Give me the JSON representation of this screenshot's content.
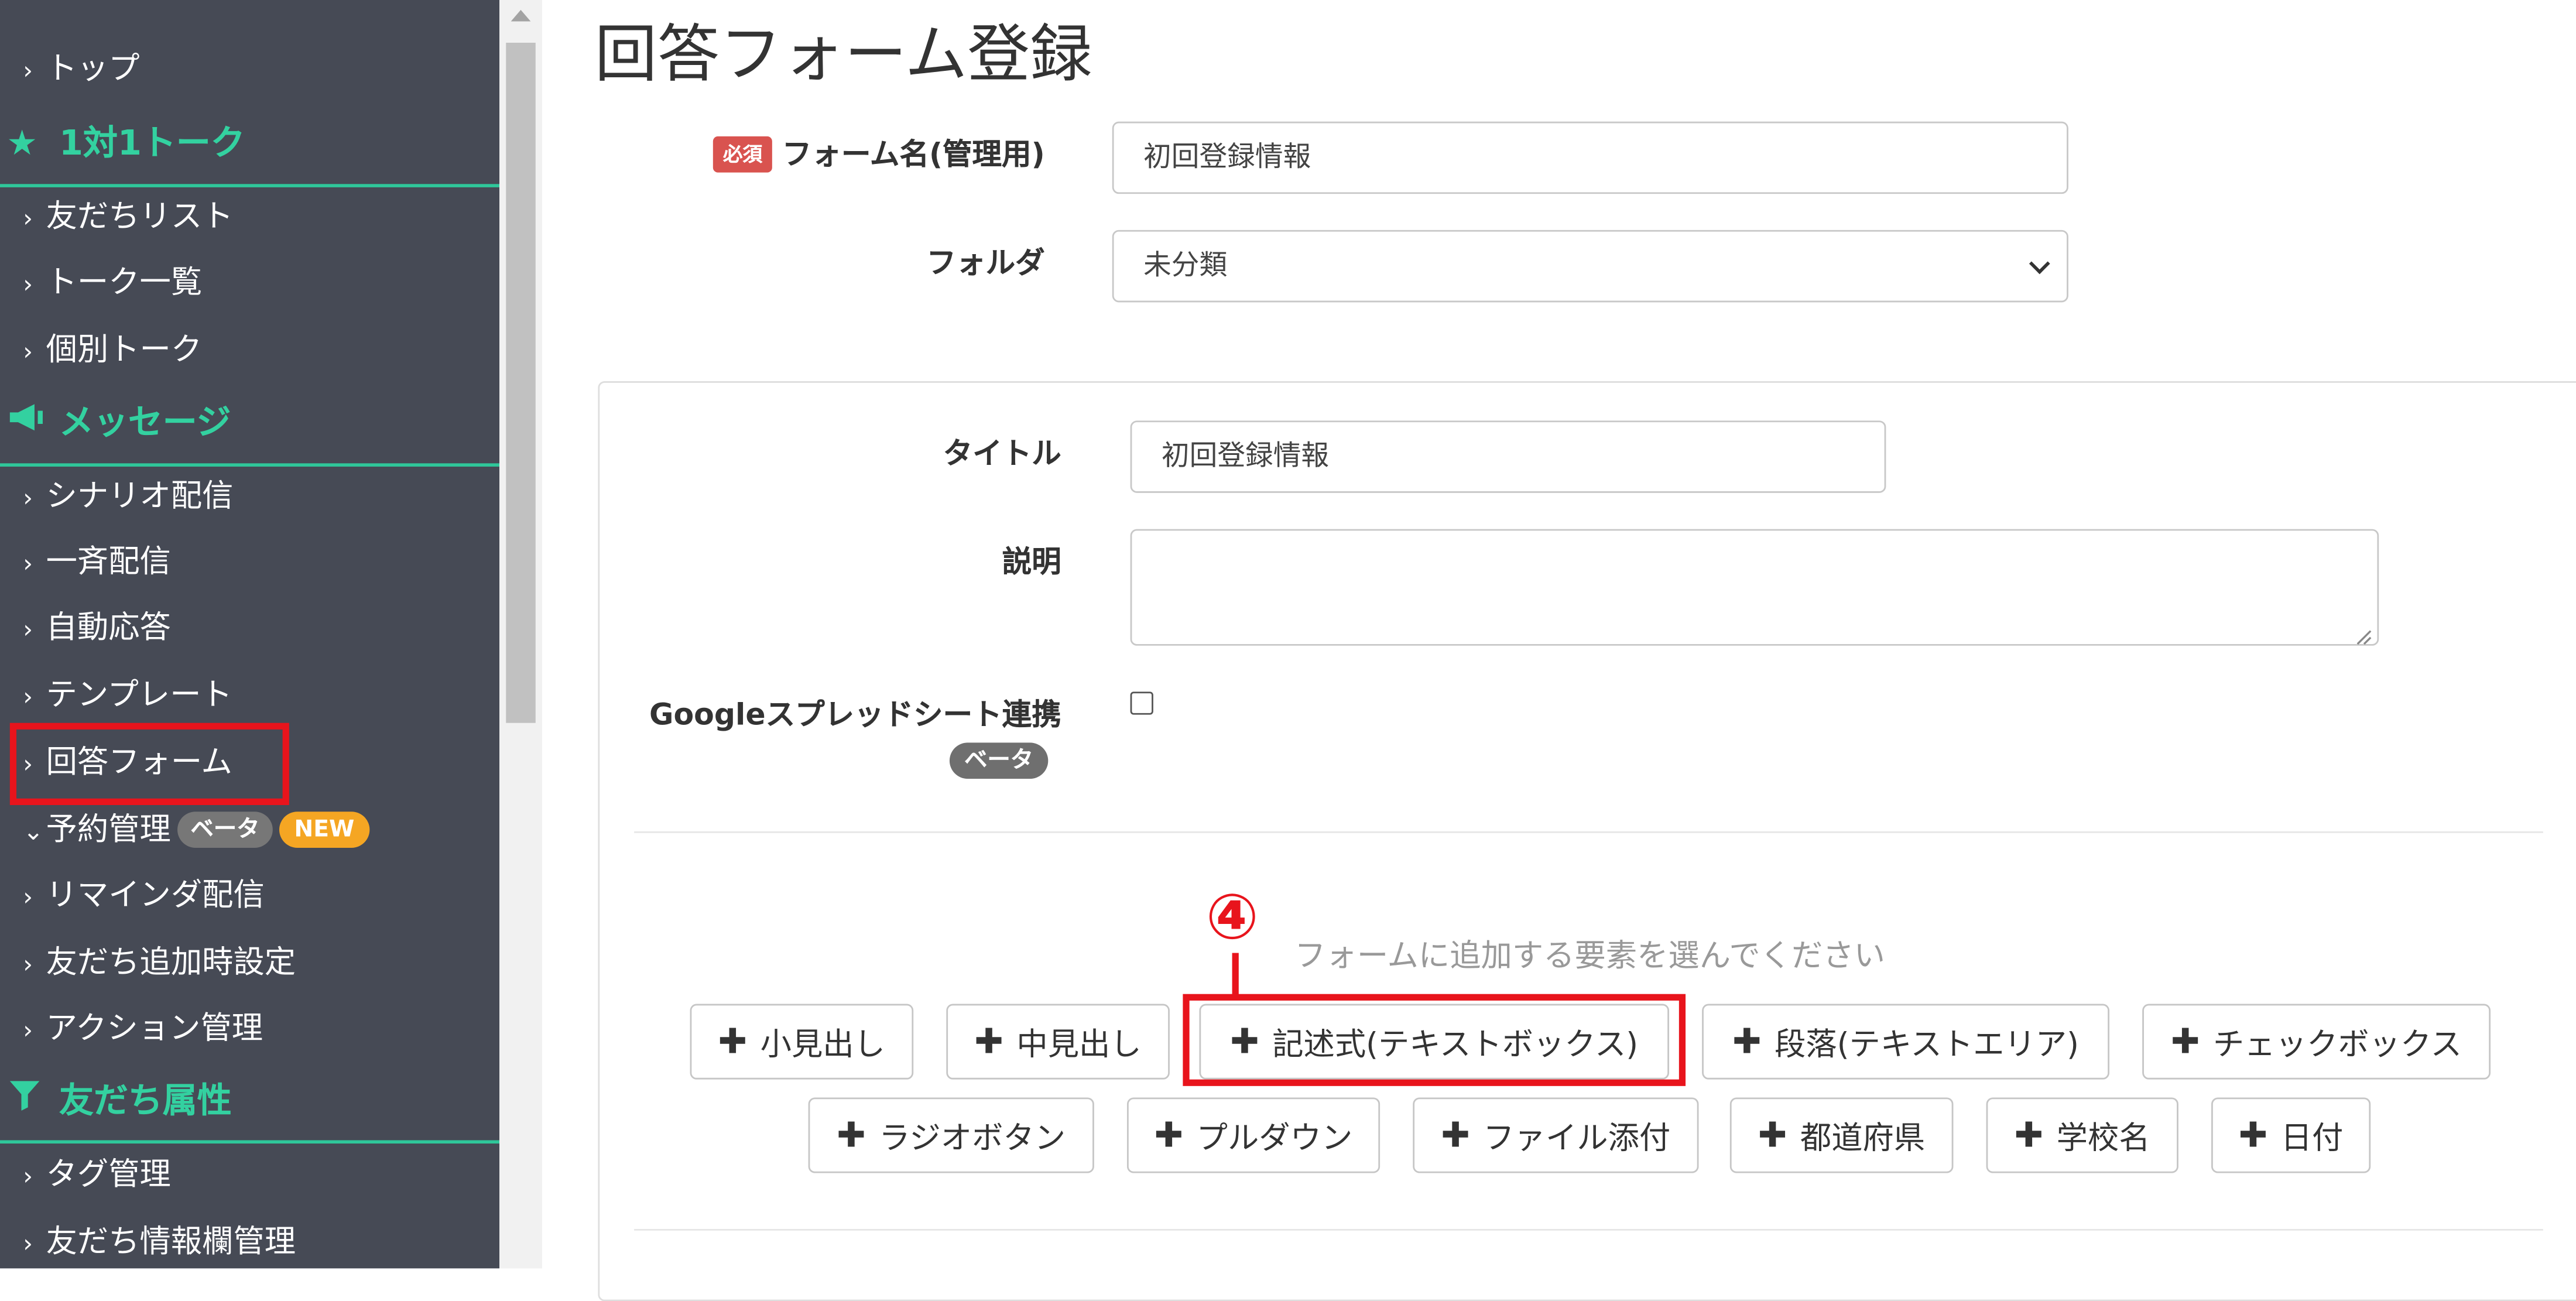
{
  "sidebar": {
    "items": {
      "top": "トップ",
      "friend_list": "友だちリスト",
      "talk_list": "トーク一覧",
      "individual_talk": "個別トーク",
      "scenario": "シナリオ配信",
      "broadcast": "一斉配信",
      "auto_reply": "自動応答",
      "template": "テンプレート",
      "answer_form": "回答フォーム",
      "reservation": "予約管理",
      "reminder": "リマインダ配信",
      "friend_add_settings": "友だち追加時設定",
      "action_mgmt": "アクション管理",
      "tag_mgmt": "タグ管理",
      "friend_info_mgmt": "友だち情報欄管理"
    },
    "sections": {
      "one_on_one": "1対1トーク",
      "message": "メッセージ",
      "friend_attr": "友だち属性"
    },
    "badges": {
      "beta": "ベータ",
      "new": "NEW"
    },
    "colors": {
      "background": "#464a55",
      "section": "#33d1a0",
      "highlight": "#e8141c"
    }
  },
  "page": {
    "title": "回答フォーム登録",
    "required_label": "必須",
    "form_name_label": "フォーム名(管理用)",
    "form_name_value": "初回登録情報",
    "folder_label": "フォルダ",
    "folder_value": "未分類"
  },
  "panel": {
    "title_label": "タイトル",
    "title_value": "初回登録情報",
    "description_label": "説明",
    "description_value": "",
    "sheets_label": "Googleスプレッドシート連携",
    "sheets_badge": "ベータ",
    "sheets_checked": false,
    "add_hint": "フォームに追加する要素を選んでください",
    "annotation": "④",
    "buttons": {
      "small_heading": "小見出し",
      "medium_heading": "中見出し",
      "text_box": "記述式(テキストボックス)",
      "paragraph": "段落(テキストエリア)",
      "checkbox": "チェックボックス",
      "radio": "ラジオボタン",
      "pulldown": "プルダウン",
      "file": "ファイル添付",
      "prefecture": "都道府県",
      "school": "学校名",
      "date": "日付"
    }
  }
}
